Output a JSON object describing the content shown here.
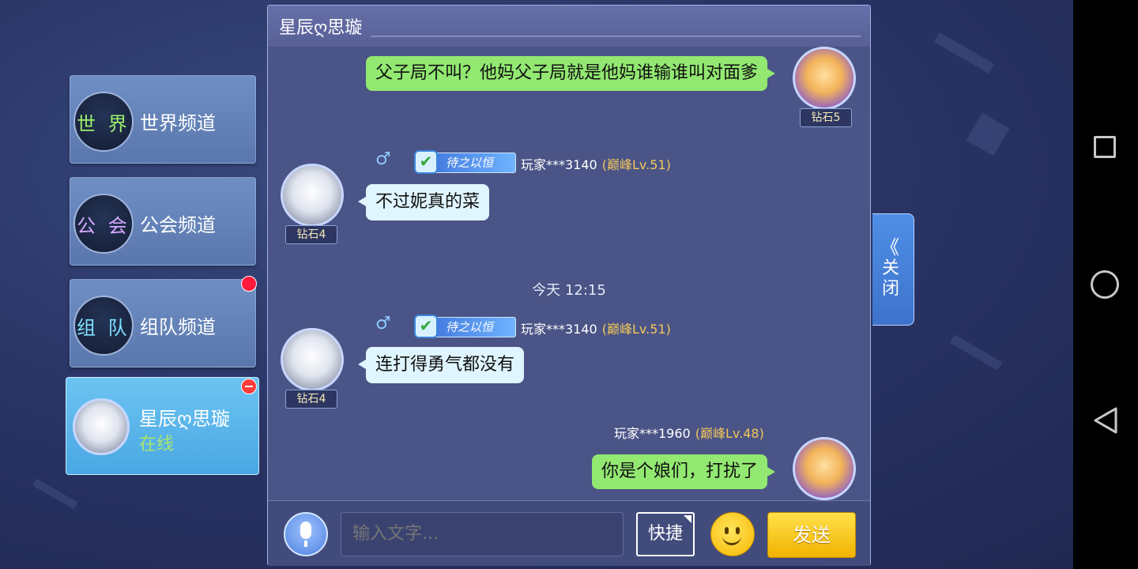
{
  "channels": [
    {
      "badge": "世 界",
      "label": "世界频道",
      "badge_color": "#9cf06a"
    },
    {
      "badge": "公 会",
      "label": "公会频道",
      "badge_color": "#d6a8ff"
    },
    {
      "badge": "组 队",
      "label": "组队频道",
      "badge_color": "#7fe1ff"
    }
  ],
  "active_contact": {
    "name": "星辰ღ思璇",
    "status": "在线"
  },
  "chat": {
    "title": "星辰ღ思璇",
    "messages": [
      {
        "text": "父子局不叫？他妈父子局就是他妈谁输谁叫对面爹",
        "rank": "钻石5",
        "side": "right"
      },
      {
        "text": "不过妮真的菜",
        "rank": "钻石4",
        "player": "玩家***3140",
        "level": "(巅峰Lv.51)",
        "title_badge": "待之以恒",
        "side": "left"
      },
      {
        "text": "连打得勇气都没有",
        "rank": "钻石4",
        "player": "玩家***3140",
        "level": "(巅峰Lv.51)",
        "title_badge": "待之以恒",
        "side": "left"
      },
      {
        "text": "你是个娘们，打扰了",
        "player": "玩家***1960",
        "level": "(巅峰Lv.48)",
        "side": "right"
      }
    ],
    "timestamp": "今天 12:15"
  },
  "input": {
    "placeholder": "输入文字...",
    "quick_label": "快捷",
    "send_label": "发送"
  },
  "close_tab": {
    "arrows": "《",
    "label": "关闭"
  },
  "icons": {
    "male": "♂",
    "check": "✔"
  },
  "colors": {
    "player_green_bubble": "#92e871",
    "other_white_bubble": "#dff5ff",
    "level_gold": "#f4c75b",
    "send_yellow": "#f1b300"
  }
}
